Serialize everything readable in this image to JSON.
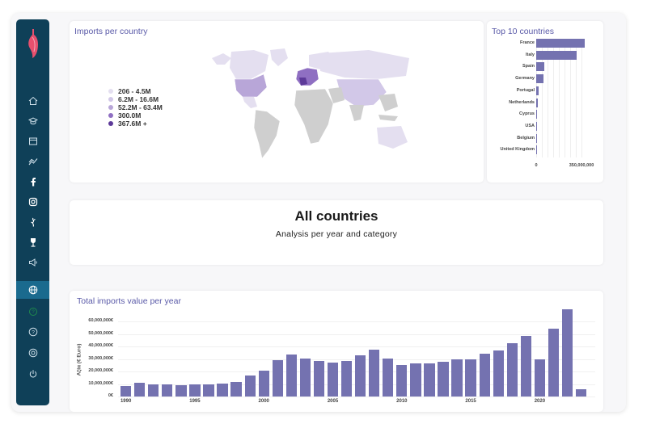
{
  "map_card": {
    "title": "Imports per country",
    "legend": [
      {
        "label": "206 - 4.5M",
        "color": "#e4dff0"
      },
      {
        "label": "6.2M - 16.6M",
        "color": "#d2c8e8"
      },
      {
        "label": "52.2M - 63.4M",
        "color": "#b8a6d8"
      },
      {
        "label": "300.0M",
        "color": "#8f6fc2"
      },
      {
        "label": "367.6M +",
        "color": "#5d3a99"
      }
    ]
  },
  "top_card": {
    "title": "Top 10 countries",
    "chart_data": {
      "type": "bar",
      "orientation": "horizontal",
      "categories": [
        "France",
        "Italy",
        "Spain",
        "Germany",
        "Portugal",
        "Netherlands",
        "Cyprus",
        "USA",
        "Belgium",
        "United Kingdom"
      ],
      "values": [
        372000000,
        310000000,
        62000000,
        55000000,
        18000000,
        14000000,
        9000000,
        7000000,
        4000000,
        2000000
      ],
      "xticks": [
        "0",
        "350,000,000"
      ],
      "xlim": [
        0,
        350000000
      ]
    }
  },
  "summary_card": {
    "title": "All countries",
    "subtitle": "Analysis per year and category"
  },
  "yearly_card": {
    "title": "Total imports value per year",
    "chart_data": {
      "type": "bar",
      "ylabel": "Αξία (€ Εuro)",
      "yticks": [
        "0€",
        "10,000,000€",
        "20,000,000€",
        "30,000,000€",
        "40,000,000€",
        "50,000,000€",
        "60,000,000€"
      ],
      "ylim": [
        0,
        60000000
      ],
      "xticks": [
        "1990",
        "1995",
        "2000",
        "2005",
        "2010",
        "2015",
        "2020"
      ],
      "x": [
        1990,
        1991,
        1992,
        1993,
        1994,
        1995,
        1996,
        1997,
        1998,
        1999,
        2000,
        2001,
        2002,
        2003,
        2004,
        2005,
        2006,
        2007,
        2008,
        2009,
        2010,
        2011,
        2012,
        2013,
        2014,
        2015,
        2016,
        2017,
        2018,
        2019,
        2020,
        2021,
        2022,
        2023
      ],
      "values": [
        8500000,
        11000000,
        9500000,
        9500000,
        9000000,
        9500000,
        10000000,
        10500000,
        11500000,
        17000000,
        20500000,
        29000000,
        33500000,
        30500000,
        28500000,
        27000000,
        28500000,
        33000000,
        37500000,
        30500000,
        25000000,
        26500000,
        26500000,
        27500000,
        30000000,
        30000000,
        34500000,
        37000000,
        42500000,
        48500000,
        29500000,
        54500000,
        70000000,
        6000000
      ]
    }
  },
  "nav": [
    {
      "name": "home-icon"
    },
    {
      "name": "graduation-cap-icon"
    },
    {
      "name": "browser-window-icon"
    },
    {
      "name": "trend-chart-icon"
    },
    {
      "name": "facebook-icon"
    },
    {
      "name": "instagram-icon"
    },
    {
      "name": "vine-icon"
    },
    {
      "name": "wine-glass-icon"
    },
    {
      "name": "megaphone-icon"
    },
    {
      "name": "globe-icon"
    },
    {
      "name": "help-circle-icon"
    },
    {
      "name": "question-icon"
    },
    {
      "name": "settings-icon"
    },
    {
      "name": "power-icon"
    }
  ],
  "colors": {
    "sidebar": "#0f4058",
    "active": "#1a6a8e",
    "bar": "#7472b0",
    "title": "#5a5aa8"
  }
}
